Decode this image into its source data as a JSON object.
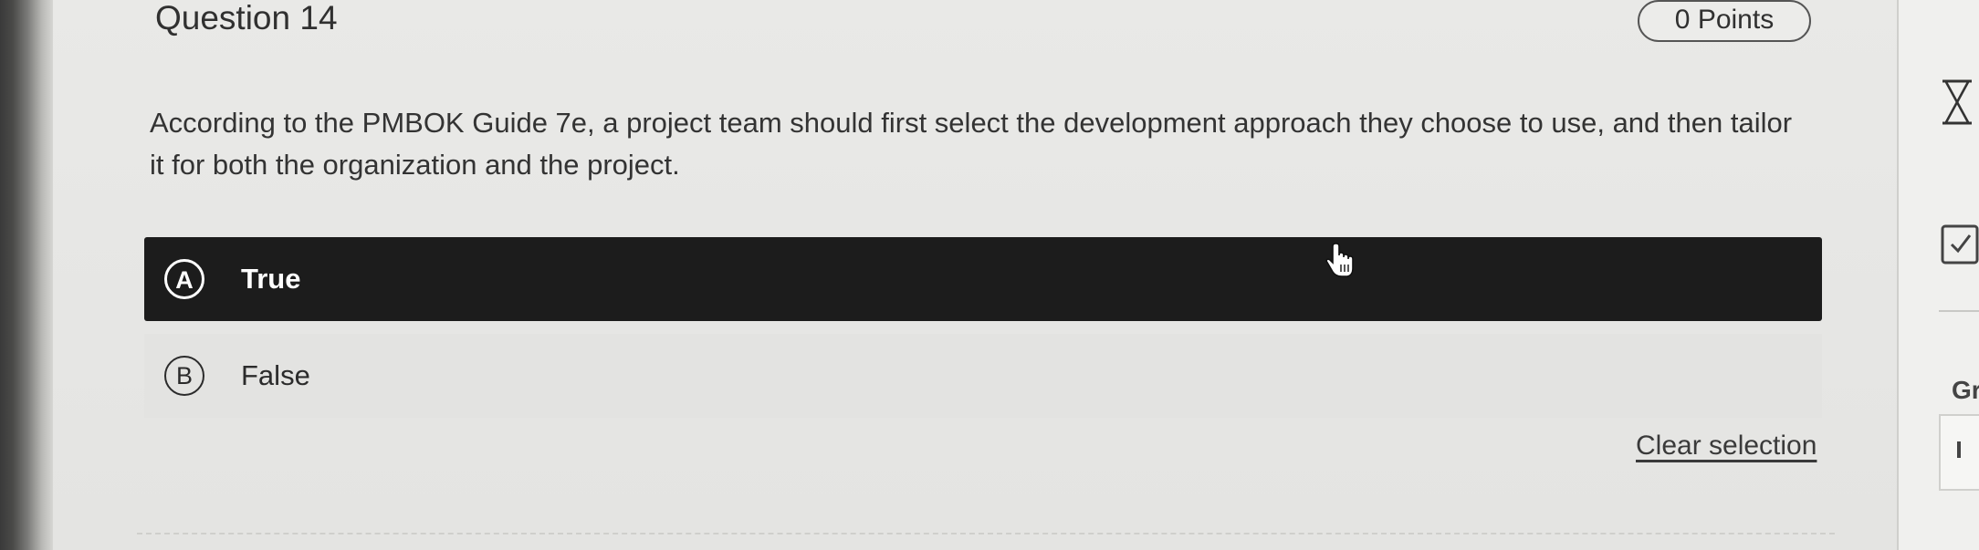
{
  "question": {
    "title": "Question 14",
    "points": "0 Points",
    "text": "According to the PMBOK Guide 7e, a project team should first select the development approach they choose to use, and then tailor it for both the organization and the project."
  },
  "options": [
    {
      "letter": "A",
      "label": "True",
      "selected": true
    },
    {
      "letter": "B",
      "label": "False",
      "selected": false
    }
  ],
  "actions": {
    "clear_selection": "Clear selection"
  },
  "sidebar": {
    "partial_label": "Gr",
    "icons": [
      "hourglass-icon",
      "checkbox-icon"
    ]
  },
  "colors": {
    "selected_bg": "#1c1c1c",
    "unselected_bg": "#e3e3e1",
    "page_bg": "#e7e7e5"
  }
}
